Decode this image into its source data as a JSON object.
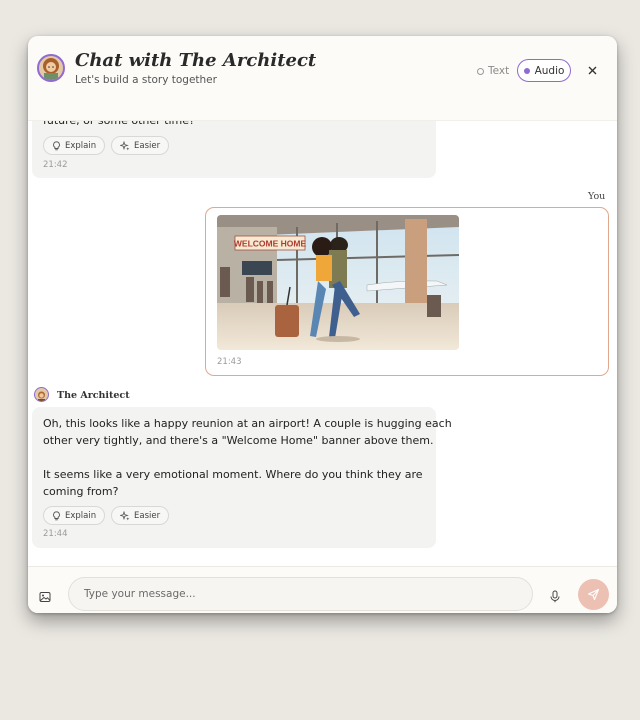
{
  "header": {
    "title": "Chat with The Architect",
    "subtitle": "Let's build a story together",
    "mode_text": "Text",
    "mode_audio": "Audio",
    "accent_color": "#8f6bd1"
  },
  "messages": {
    "previous": {
      "text_fragment": "future, or some other time?",
      "time": "21:42",
      "explain_label": "Explain",
      "easier_label": "Easier"
    },
    "user": {
      "sender": "You",
      "time": "21:43",
      "image_banner": "WELCOME HOME",
      "border_color": "#e0a98d"
    },
    "reply": {
      "sender": "The Architect",
      "lines": [
        "Oh, this looks like a happy reunion at an airport! A couple is hugging each",
        "other very tightly, and there's a \"Welcome Home\" banner above them.",
        "It seems like a very emotional moment. Where do you think they are",
        "coming from?"
      ],
      "time": "21:44",
      "explain_label": "Explain",
      "easier_label": "Easier"
    }
  },
  "composer": {
    "placeholder": "Type your message...",
    "value": "",
    "send_color": "#ecc1b4"
  },
  "icons": [
    "avatar",
    "close-icon",
    "lightbulb-icon",
    "sparkle-icon",
    "image-icon",
    "mic-icon",
    "send-icon"
  ]
}
